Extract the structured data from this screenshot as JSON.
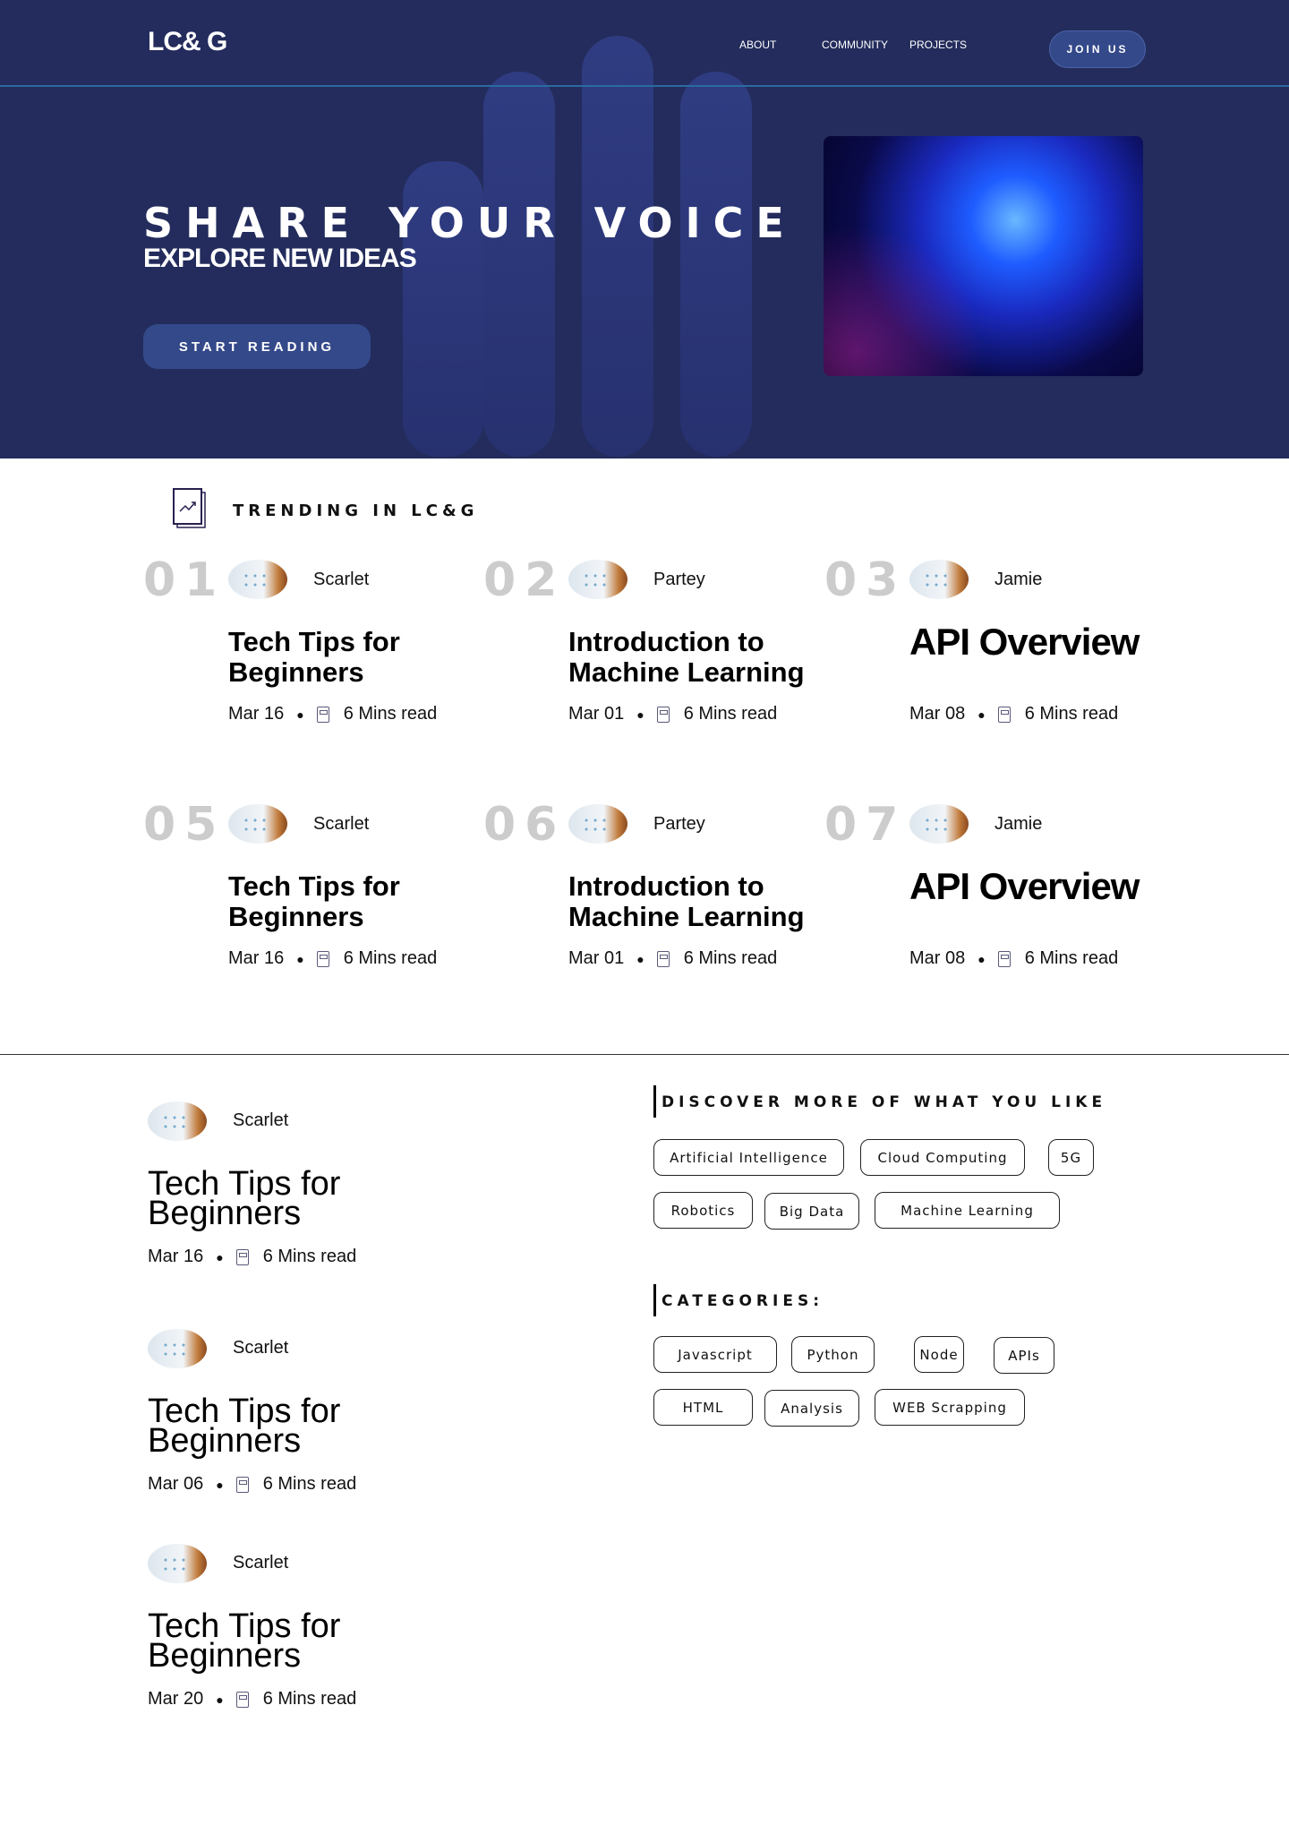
{
  "header": {
    "logo": "LC& G",
    "nav": [
      "ABOUT",
      "COMMUNITY",
      "PROJECTS"
    ],
    "join_label": "JOIN US"
  },
  "hero": {
    "title": "SHARE YOUR VOICE",
    "subtitle": "EXPLORE NEW IDEAS",
    "cta_label": "START READING",
    "bg_color": "#232c5c",
    "button_color": "#34498a"
  },
  "trending": {
    "heading": "TRENDING IN LC&G",
    "icon": "trending-up-icon",
    "items": [
      {
        "num": "01",
        "author": "Scarlet",
        "title": "Tech Tips for Beginners",
        "date": "Mar 16",
        "read": "6 Mins read"
      },
      {
        "num": "02",
        "author": "Partey",
        "title": "Introduction to Machine Learning",
        "date": "Mar 01",
        "read": "6 Mins read"
      },
      {
        "num": "03",
        "author": "Jamie",
        "title": "API Overview",
        "date": "Mar 08",
        "read": "6 Mins read"
      },
      {
        "num": "05",
        "author": "Scarlet",
        "title": "Tech Tips for Beginners",
        "date": "Mar 16",
        "read": "6 Mins read"
      },
      {
        "num": "06",
        "author": "Partey",
        "title": "Introduction to Machine Learning",
        "date": "Mar 01",
        "read": "6 Mins read"
      },
      {
        "num": "07",
        "author": "Jamie",
        "title": "API Overview",
        "date": "Mar 08",
        "read": "6 Mins read"
      }
    ]
  },
  "posts": [
    {
      "author": "Scarlet",
      "title": "Tech Tips for Beginners",
      "date": "Mar 16",
      "read": "6 Mins read"
    },
    {
      "author": "Scarlet",
      "title": "Tech Tips for Beginners",
      "date": "Mar 06",
      "read": "6 Mins read"
    },
    {
      "author": "Scarlet",
      "title": "Tech Tips for Beginners",
      "date": "Mar 20",
      "read": "6 Mins read"
    }
  ],
  "discover": {
    "heading": "DISCOVER MORE OF WHAT YOU LIKE",
    "tags": [
      "Artificial Intelligence",
      "Cloud Computing",
      "5G",
      "Robotics",
      "Big Data",
      "Machine Learning"
    ]
  },
  "categories": {
    "heading": "CATEGORIES:",
    "tags": [
      "Javascript",
      "Python",
      "Node",
      "APIs",
      "HTML",
      "Analysis",
      "WEB Scrapping"
    ]
  }
}
